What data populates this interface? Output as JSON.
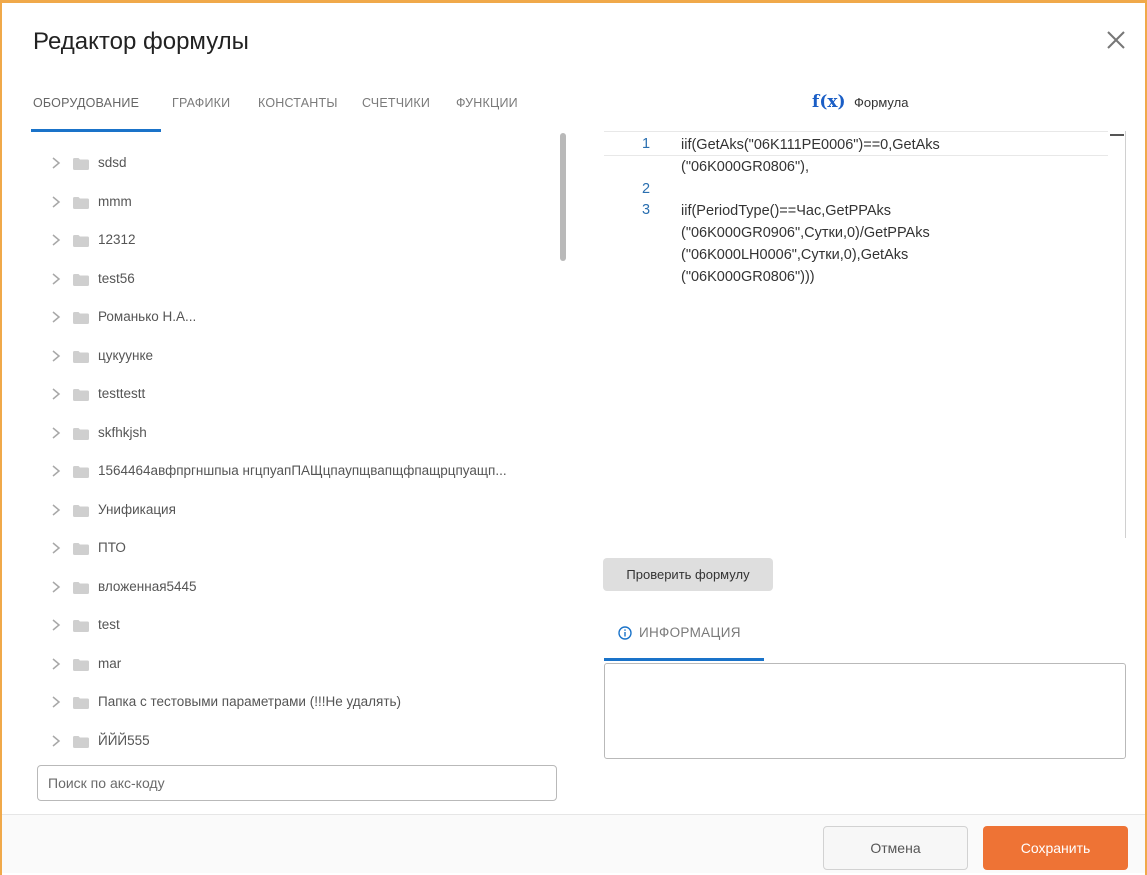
{
  "dialog": {
    "title": "Редактор формулы"
  },
  "tabs": [
    {
      "label": "ОБОРУДОВАНИЕ",
      "active": true
    },
    {
      "label": "ГРАФИКИ",
      "active": false
    },
    {
      "label": "КОНСТАНТЫ",
      "active": false
    },
    {
      "label": "СЧЕТЧИКИ",
      "active": false
    },
    {
      "label": "ФУНКЦИИ",
      "active": false
    }
  ],
  "tree": {
    "items": [
      {
        "label": "sdsd"
      },
      {
        "label": "mmm"
      },
      {
        "label": "12312"
      },
      {
        "label": "test56"
      },
      {
        "label": "Романько Н.А..."
      },
      {
        "label": "цукуунке"
      },
      {
        "label": "testtestt"
      },
      {
        "label": "skfhkjsh"
      },
      {
        "label": "1564464авфпргншпыа нгцпуапПАЩцпаупщвапщфпащрцпуащп..."
      },
      {
        "label": "Унификация"
      },
      {
        "label": "ПТО"
      },
      {
        "label": "вложенная5445"
      },
      {
        "label": "test"
      },
      {
        "label": "mar"
      },
      {
        "label": "Папка с тестовыми параметрами (!!!Не удалять)"
      },
      {
        "label": "ЙЙЙ555"
      }
    ]
  },
  "search": {
    "placeholder": "Поиск по акс-коду",
    "value": ""
  },
  "formula": {
    "icon_text": "f(x)",
    "label": "Формула",
    "lines": [
      {
        "number": "1",
        "code": "iif(GetAks(\"06K111PE0006\")==0,GetAks\n(\"06K000GR0806\"),"
      },
      {
        "number": "2",
        "code": ""
      },
      {
        "number": "3",
        "code": "iif(PeriodType()==Час,GetPPAks\n(\"06K000GR0906\",Сутки,0)/GetPPAks\n(\"06K000LH0006\",Сутки,0),GetAks\n(\"06K000GR0806\")))"
      }
    ]
  },
  "check_button": {
    "label": "Проверить формулу"
  },
  "info": {
    "tab_label": "ИНФОРМАЦИЯ",
    "text": ""
  },
  "footer": {
    "cancel_label": "Отмена",
    "save_label": "Сохранить"
  },
  "colors": {
    "accent_blue": "#1a73c9",
    "save_orange": "#ee7335",
    "frame_orange": "#f0a94a",
    "fx_blue": "#1a5ec6"
  }
}
